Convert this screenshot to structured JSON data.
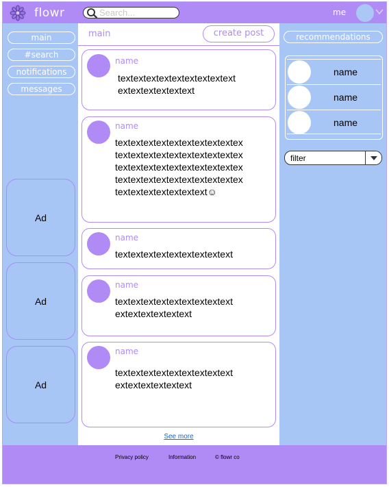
{
  "header": {
    "brand": "flowr",
    "search_placeholder": "Search...",
    "user_label": "me"
  },
  "nav": {
    "items": [
      {
        "label": "main"
      },
      {
        "label": "#search"
      },
      {
        "label": "notifications"
      },
      {
        "label": "messages"
      }
    ]
  },
  "ads": [
    "Ad",
    "Ad",
    "Ad"
  ],
  "feed": {
    "active_tab": "main",
    "create_post_label": "create post",
    "posts": [
      {
        "name": "name",
        "text": "textextextextextextextextext\nextextextextextext"
      },
      {
        "name": "name",
        "text": "textextextextextextextextextex\ntextextextextextextextextextex\ntextextextextextextextextextex\ntextextextextextextextextextex\ntextextextextextextext☺"
      },
      {
        "name": "name",
        "text": "textextextextextextextextext"
      },
      {
        "name": "name",
        "text": "textextextextextextextextext\nextextextextextext"
      },
      {
        "name": "name",
        "text": "textextextextextextextextext\nextextextextextext"
      }
    ],
    "see_more": "See more"
  },
  "recommendations": {
    "label": "recommendations",
    "people": [
      {
        "name": "name"
      },
      {
        "name": "name"
      },
      {
        "name": "name"
      }
    ],
    "filter_value": "filter"
  },
  "footer": {
    "links": [
      "Privacy policy",
      "Information",
      "© flowr co"
    ]
  },
  "colors": {
    "purple": "#b08af5",
    "blue": "#a7c5f5",
    "link": "#1a64c9"
  },
  "icons": [
    "flower-logo-icon",
    "search-icon",
    "chevron-down-icon",
    "dropdown-arrow-icon"
  ]
}
